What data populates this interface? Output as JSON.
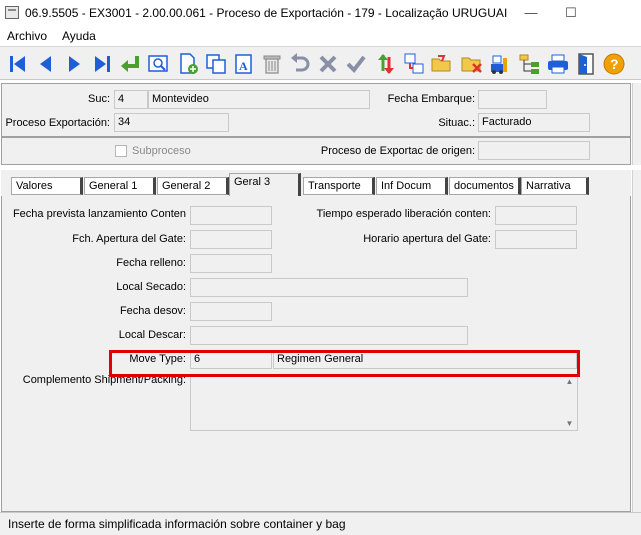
{
  "window": {
    "title": "06.9.5505 - EX3001 - 2.00.00.061 - Proceso de Exportación - 179 - Localização URUGUAI",
    "minimize": "—",
    "maximize": "☐"
  },
  "menu": [
    "Archivo",
    "Ayuda"
  ],
  "toolbar": [
    "first-record",
    "previous-record",
    "next-record",
    "last-record",
    "go-to",
    "search",
    "new",
    "copy",
    "edit",
    "delete",
    "undo",
    "cancel",
    "confirm",
    "sort",
    "related",
    "open",
    "clear",
    "export",
    "tree",
    "print",
    "exit",
    "help"
  ],
  "header": {
    "suc_label": "Suc:",
    "suc_code": "4",
    "suc_name": "Montevideo",
    "fecha_embarque_label": "Fecha Embarque:",
    "fecha_embarque_value": "",
    "proceso_label": "Proceso Exportación:",
    "proceso_value": "34",
    "situac_label": "Situac.:",
    "situac_value": "Facturado",
    "subproceso_label": "Subproceso",
    "origen_label": "Proceso de Exportac de origen:",
    "origen_value": ""
  },
  "tabs": [
    "Valores",
    "General 1",
    "General 2",
    "Geral 3",
    "Transporte",
    "Inf Docum",
    "documentos",
    "Narrativa"
  ],
  "active_tab": "Geral 3",
  "form": {
    "fecha_prevista_label": "Fecha prevista lanzamiento Conten",
    "fecha_prevista_value": "",
    "tiempo_esperado_label": "Tiempo esperado liberación conten:",
    "tiempo_esperado_value": "",
    "fch_apertura_label": "Fch. Apertura del Gate:",
    "fch_apertura_value": "",
    "horario_apertura_label": "Horario apertura del Gate:",
    "horario_apertura_value": "",
    "fecha_relleno_label": "Fecha relleno:",
    "fecha_relleno_value": "",
    "local_secado_label": "Local Secado:",
    "local_secado_value": "",
    "fecha_desov_label": "Fecha desov:",
    "fecha_desov_value": "",
    "local_descar_label": "Local Descar:",
    "local_descar_value": "",
    "move_type_label": "Move Type:",
    "move_type_code": "6",
    "move_type_desc": "Regimen General",
    "complemento_label": "Complemento Shipment/Packing:",
    "complemento_value": ""
  },
  "status": {
    "text": "Inserte de forma simplificada información sobre container y bag"
  },
  "colors": {
    "highlight": "#e00000",
    "nav_blue": "#1e5fd8",
    "confirm_green": "#4aa02c",
    "help_orange": "#f0a000"
  }
}
